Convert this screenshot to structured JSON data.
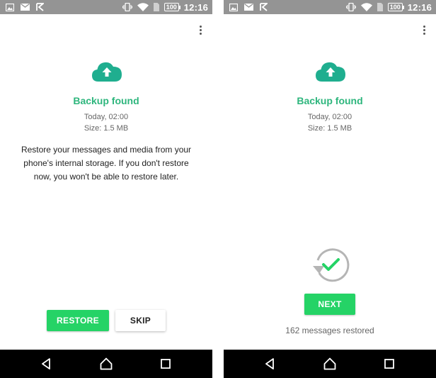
{
  "status_bar": {
    "time": "12:16",
    "battery": "100",
    "icons_left": [
      "image-icon",
      "mail-icon",
      "messaging-icon"
    ],
    "icons_right": [
      "vibrate-icon",
      "wifi-icon",
      "sim-icon",
      "battery-icon"
    ]
  },
  "screen_left": {
    "title": "Backup found",
    "date": "Today, 02:00",
    "size": "Size: 1.5 MB",
    "description": "Restore your messages and media from your phone's internal storage. If you don't restore now, you won't be able to restore later.",
    "restore_label": "RESTORE",
    "skip_label": "SKIP"
  },
  "screen_right": {
    "title": "Backup found",
    "date": "Today, 02:00",
    "size": "Size: 1.5 MB",
    "next_label": "NEXT",
    "restored_text": "162 messages restored"
  },
  "nav_bar": {
    "icons": [
      "back-icon",
      "home-icon",
      "recents-icon"
    ]
  },
  "colors": {
    "accent_green": "#25d366",
    "title_teal": "#2eb67d",
    "cloud_teal": "#1fae8f",
    "status_bar": "#949494"
  }
}
